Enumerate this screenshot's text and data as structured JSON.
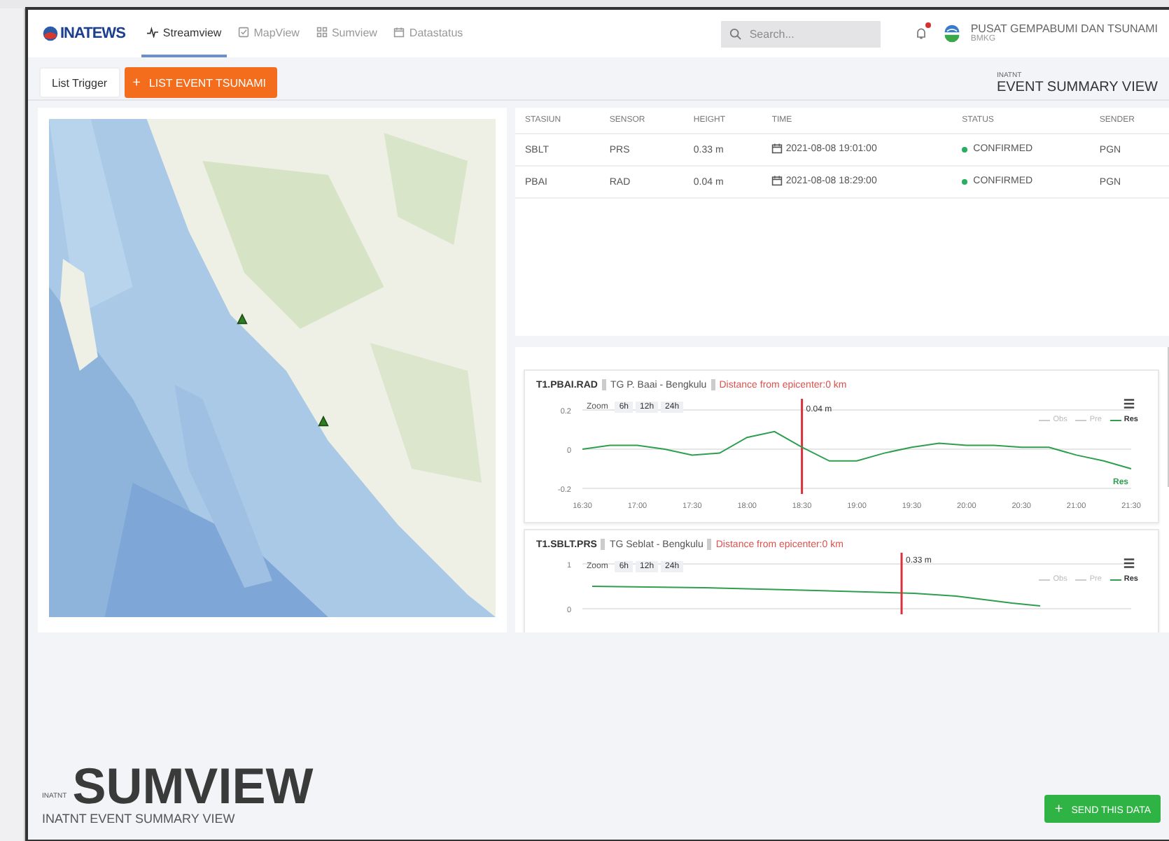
{
  "header": {
    "logo": "INATEWS",
    "nav": [
      {
        "label": "Streamview",
        "selected": true
      },
      {
        "label": "MapView",
        "selected": false
      },
      {
        "label": "Sumview",
        "selected": false
      },
      {
        "label": "Datastatus",
        "selected": false
      }
    ],
    "search": {
      "placeholder": "Search..."
    },
    "notification": {
      "unread": true
    },
    "org": {
      "name": "PUSAT GEMPABUMI DAN TSUNAMI",
      "sub": "BMKG"
    }
  },
  "toolbar": {
    "buttons": [
      {
        "label": "List Trigger",
        "kind": "plain"
      },
      {
        "label": "LIST EVENT TSUNAMI",
        "kind": "primary",
        "icon": "+"
      }
    ],
    "context": {
      "small": "INATNT",
      "title": "EVENT SUMMARY VIEW"
    }
  },
  "table": {
    "columns": [
      "STASIUN",
      "SENSOR",
      "HEIGHT",
      "TIME",
      "STATUS",
      "SENDER"
    ],
    "rows": [
      {
        "station": "SBLT",
        "sensor": "PRS",
        "height": "0.33 m",
        "time": "2021-08-08 19:01:00",
        "status": {
          "label": "CONFIRMED",
          "color": "#27ae60"
        },
        "sender": "PGN"
      },
      {
        "station": "PBAI",
        "sensor": "RAD",
        "height": "0.04 m",
        "time": "2021-08-08 18:29:00",
        "status": {
          "label": "CONFIRMED",
          "color": "#27ae60"
        },
        "sender": "PGN"
      }
    ]
  },
  "charts": [
    {
      "id": "T1.PBAI.RAD",
      "location": "TG P. Baai - Bengkulu",
      "distance": "Distance from epicenter:0 km",
      "zoom": {
        "label": "Zoom",
        "ranges": [
          "6h",
          "12h",
          "24h"
        ]
      },
      "legend": [
        {
          "label": "Obs",
          "on": false
        },
        {
          "label": "Pre",
          "on": false
        },
        {
          "label": "Res",
          "on": true
        }
      ],
      "chart_data": {
        "type": "line",
        "x": [
          16.5,
          16.75,
          17,
          17.25,
          17.5,
          17.75,
          18,
          18.25,
          18.5,
          18.75,
          19,
          19.25,
          19.5,
          19.75,
          20,
          20.25,
          20.5,
          20.75,
          21,
          21.25,
          21.5
        ],
        "series": [
          {
            "name": "Res",
            "color": "#2e9e4f",
            "values": [
              0,
              0.02,
              0.02,
              0,
              -0.03,
              -0.02,
              0.06,
              0.09,
              0.01,
              -0.06,
              -0.06,
              -0.02,
              0.01,
              0.03,
              0.02,
              0.02,
              0.01,
              0.01,
              -0.03,
              -0.06,
              -0.1
            ]
          }
        ],
        "xlim": [
          16.5,
          21.5
        ],
        "ylim": [
          -0.2,
          0.2
        ],
        "yticks": [
          0.2,
          0,
          -0.2
        ],
        "xticks": [
          {
            "value": 16.5,
            "label": "16:30"
          },
          {
            "value": 17,
            "label": "17:00"
          },
          {
            "value": 17.5,
            "label": "17:30"
          },
          {
            "value": 18,
            "label": "18:00"
          },
          {
            "value": 18.5,
            "label": "18:30"
          },
          {
            "value": 19,
            "label": "19:00"
          },
          {
            "value": 19.5,
            "label": "19:30"
          },
          {
            "value": 20,
            "label": "20:00"
          },
          {
            "value": 20.5,
            "label": "20:30"
          },
          {
            "value": 21,
            "label": "21:00"
          },
          {
            "value": 21.5,
            "label": "21:30"
          }
        ],
        "ref_lines": [
          {
            "axis": "x",
            "value": 18.5,
            "color": "#d9303e"
          }
        ],
        "annotations": [
          "0.04 m"
        ]
      }
    },
    {
      "id": "T1.SBLT.PRS",
      "location": "TG Seblat - Bengkulu",
      "distance": "Distance from epicenter:0 km",
      "zoom": {
        "label": "Zoom",
        "ranges": [
          "6h",
          "12h",
          "24h"
        ]
      },
      "legend": [
        {
          "label": "Obs",
          "on": false
        },
        {
          "label": "Pre",
          "on": false
        },
        {
          "label": "Res",
          "on": true
        }
      ],
      "y_labels": [
        "1",
        "0"
      ],
      "marker_label": "0.33 m"
    }
  ],
  "footer": {
    "small": "INATNT",
    "title": "SUMVIEW",
    "subtitle": "INATNT EVENT SUMMARY VIEW",
    "send": {
      "label": "SEND THIS DATA",
      "icon": "+"
    }
  }
}
